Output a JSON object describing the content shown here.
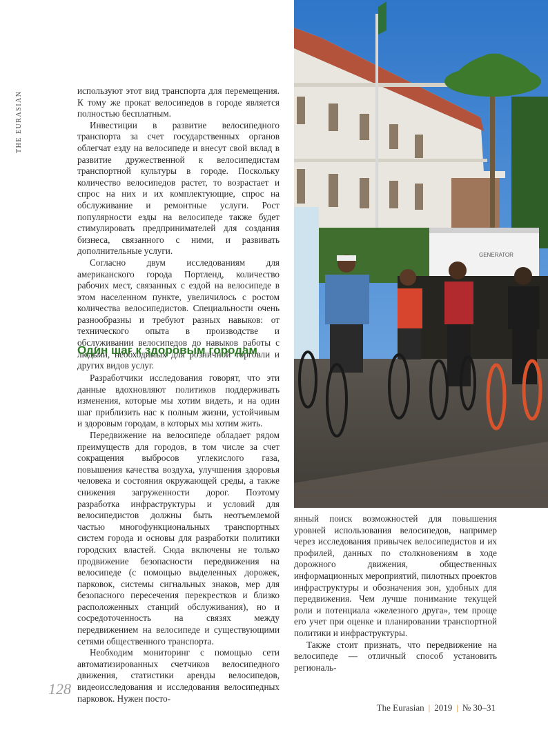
{
  "side_label": "THE EURASIAN",
  "left_top_paragraphs": [
    "используют этот вид транспорта для перемещения. К тому же прокат велосипедов в городе является полностью бесплатным.",
    "Инвестиции в развитие велосипедного транспорта за счет государственных органов облегчат езду на велосипеде и внесут свой вклад в развитие дружественной к велосипедистам транспортной культуры в городе. Поскольку количество велосипедов растет, то возрастает и спрос на них и их комплектующие, спрос на обслуживание и ремонтные услуги. Рост популярности езды на велосипеде также будет стимулировать предпринимателей для создания бизнеса, связанного с ними, и развивать дополнительные услуги.",
    "Согласно двум исследованиям для американского города Портленд, количество рабочих мест, связанных с ездой на велосипеде в этом населенном пункте, увеличилось с ростом количества велосипедистов. Специальности очень разнообразны и требуют разных навыков: от технического опыта в производстве и обслуживании велосипедов до навыков работы с людьми, необходимых для розничной торговли и других видов услуг."
  ],
  "section_heading": "Один шаг к здоровым городам",
  "left_bottom_paragraphs": [
    "Разработчики исследования говорят, что эти данные вдохновляют политиков поддерживать изменения, которые мы хотим видеть, и на один шаг приблизить нас к полным жизни, устойчивым и здоровым городам, в которых мы хотим жить.",
    "Передвижение на велосипеде обладает рядом преимуществ для городов, в том числе за счет сокращения выбросов углекислого газа, повышения качества воздуха, улучшения здоровья человека и состояния окружающей среды, а также снижения загруженности дорог. Поэтому разработка инфраструктуры и условий для велосипедистов должны быть неотъемлемой частью многофункциональных транспортных систем города и основы для разработки политики городских властей. Сюда включены не только продвижение безопасности передвижения на велосипеде (с помощью выделенных дорожек, парковок, системы сигнальных знаков, мер для безопасного пересечения перекрестков и близко расположенных станций обслуживания), но и сосредоточенность на связях между передвижением на велосипеде и существующими сетями общественного транспорта.",
    "Необходим мониторинг с помощью сети автоматизированных счетчиков велосипедного движения, статистики аренды велосипедов, видеоисследования и исследования велосипедных парковок. Нужен посто-"
  ],
  "right_paragraphs": [
    "янный поиск возможностей для повышения уровней использования велосипедов, например через исследования привычек велосипедистов и их профилей, данных по столкновениям в ходе дорожного движения, общественных информационных мероприятий, пилотных проектов инфраструктуры и обозначения зон, удобных для передвижения. Чем лучше понимание текущей роли и потенциала «железного друга», тем проще его учет при оценке и планировании транспортной политики и инфраструктуры.",
    "Также стоит признать, что передвижение на велосипеде — отличный способ установить региональ-"
  ],
  "photo": {
    "banner_text": "GENERATOR"
  },
  "page_number": "128",
  "footer": {
    "magazine": "The Eurasian",
    "year": "2019",
    "issue": "№ 30–31"
  },
  "colors": {
    "heading_green": "#2f7a27",
    "footer_separator": "#e08a2a"
  }
}
